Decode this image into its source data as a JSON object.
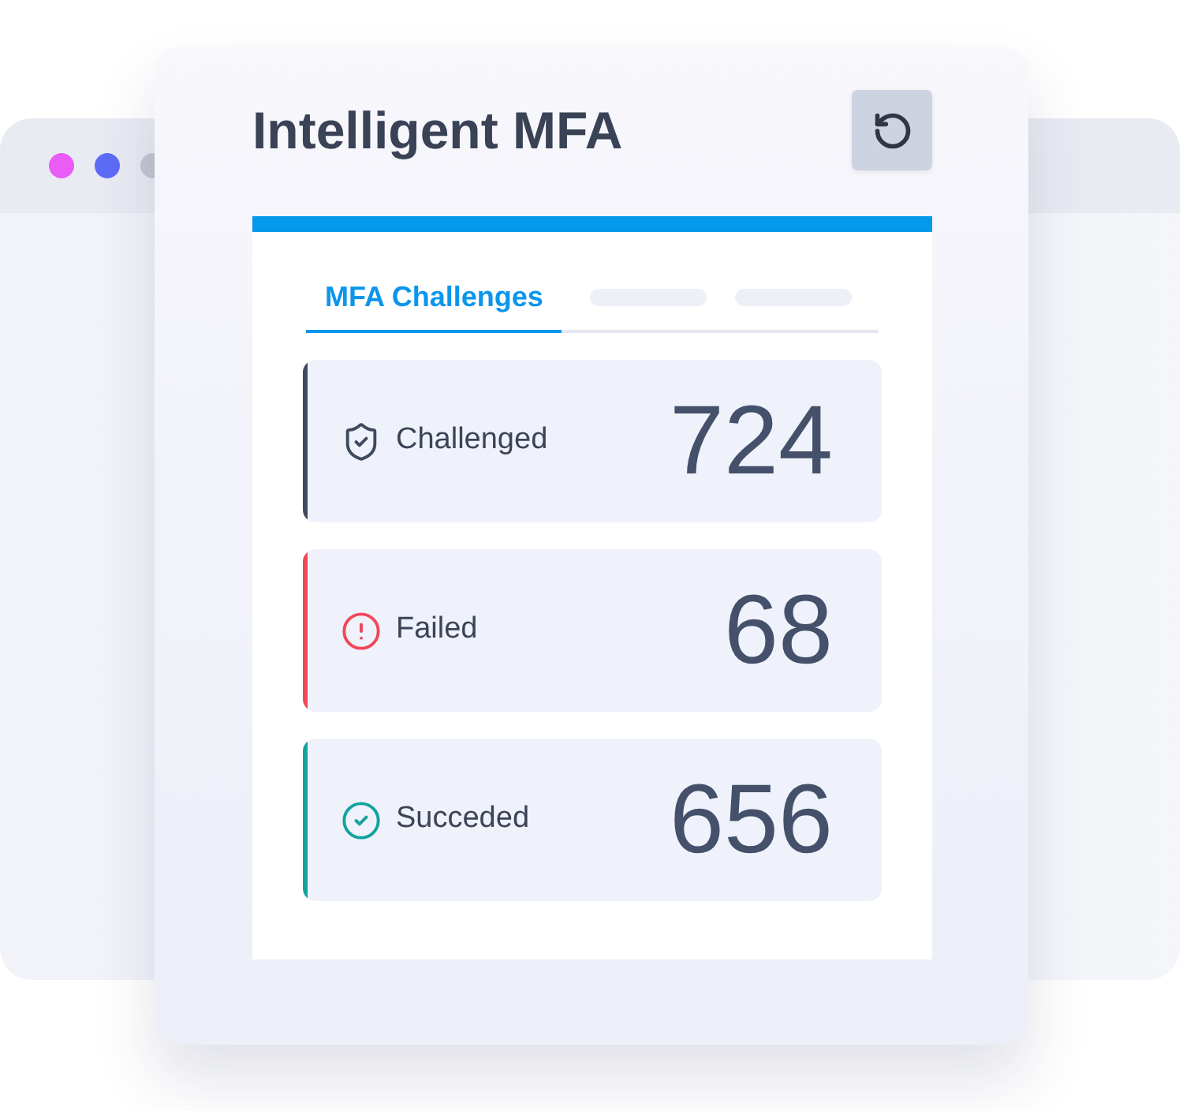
{
  "background_window": {
    "dots": [
      {
        "color": "#e95cf5"
      },
      {
        "color": "#5e6bf7"
      },
      {
        "color": "#c3c7d3"
      }
    ]
  },
  "card": {
    "title": "Intelligent MFA"
  },
  "tabs": [
    {
      "kind": "text",
      "label": "MFA Challenges",
      "selected": true
    },
    {
      "kind": "skeleton",
      "selected": false
    },
    {
      "kind": "skeleton",
      "selected": false
    }
  ],
  "stats": [
    {
      "kind": "shield",
      "label": "Challenged",
      "value": "724",
      "color": "#3f4a5e"
    },
    {
      "kind": "alert",
      "label": "Failed",
      "value": "68",
      "color": "#f0475a"
    },
    {
      "kind": "check",
      "label": "Succeded",
      "value": "656",
      "color": "#13a39d"
    }
  ]
}
